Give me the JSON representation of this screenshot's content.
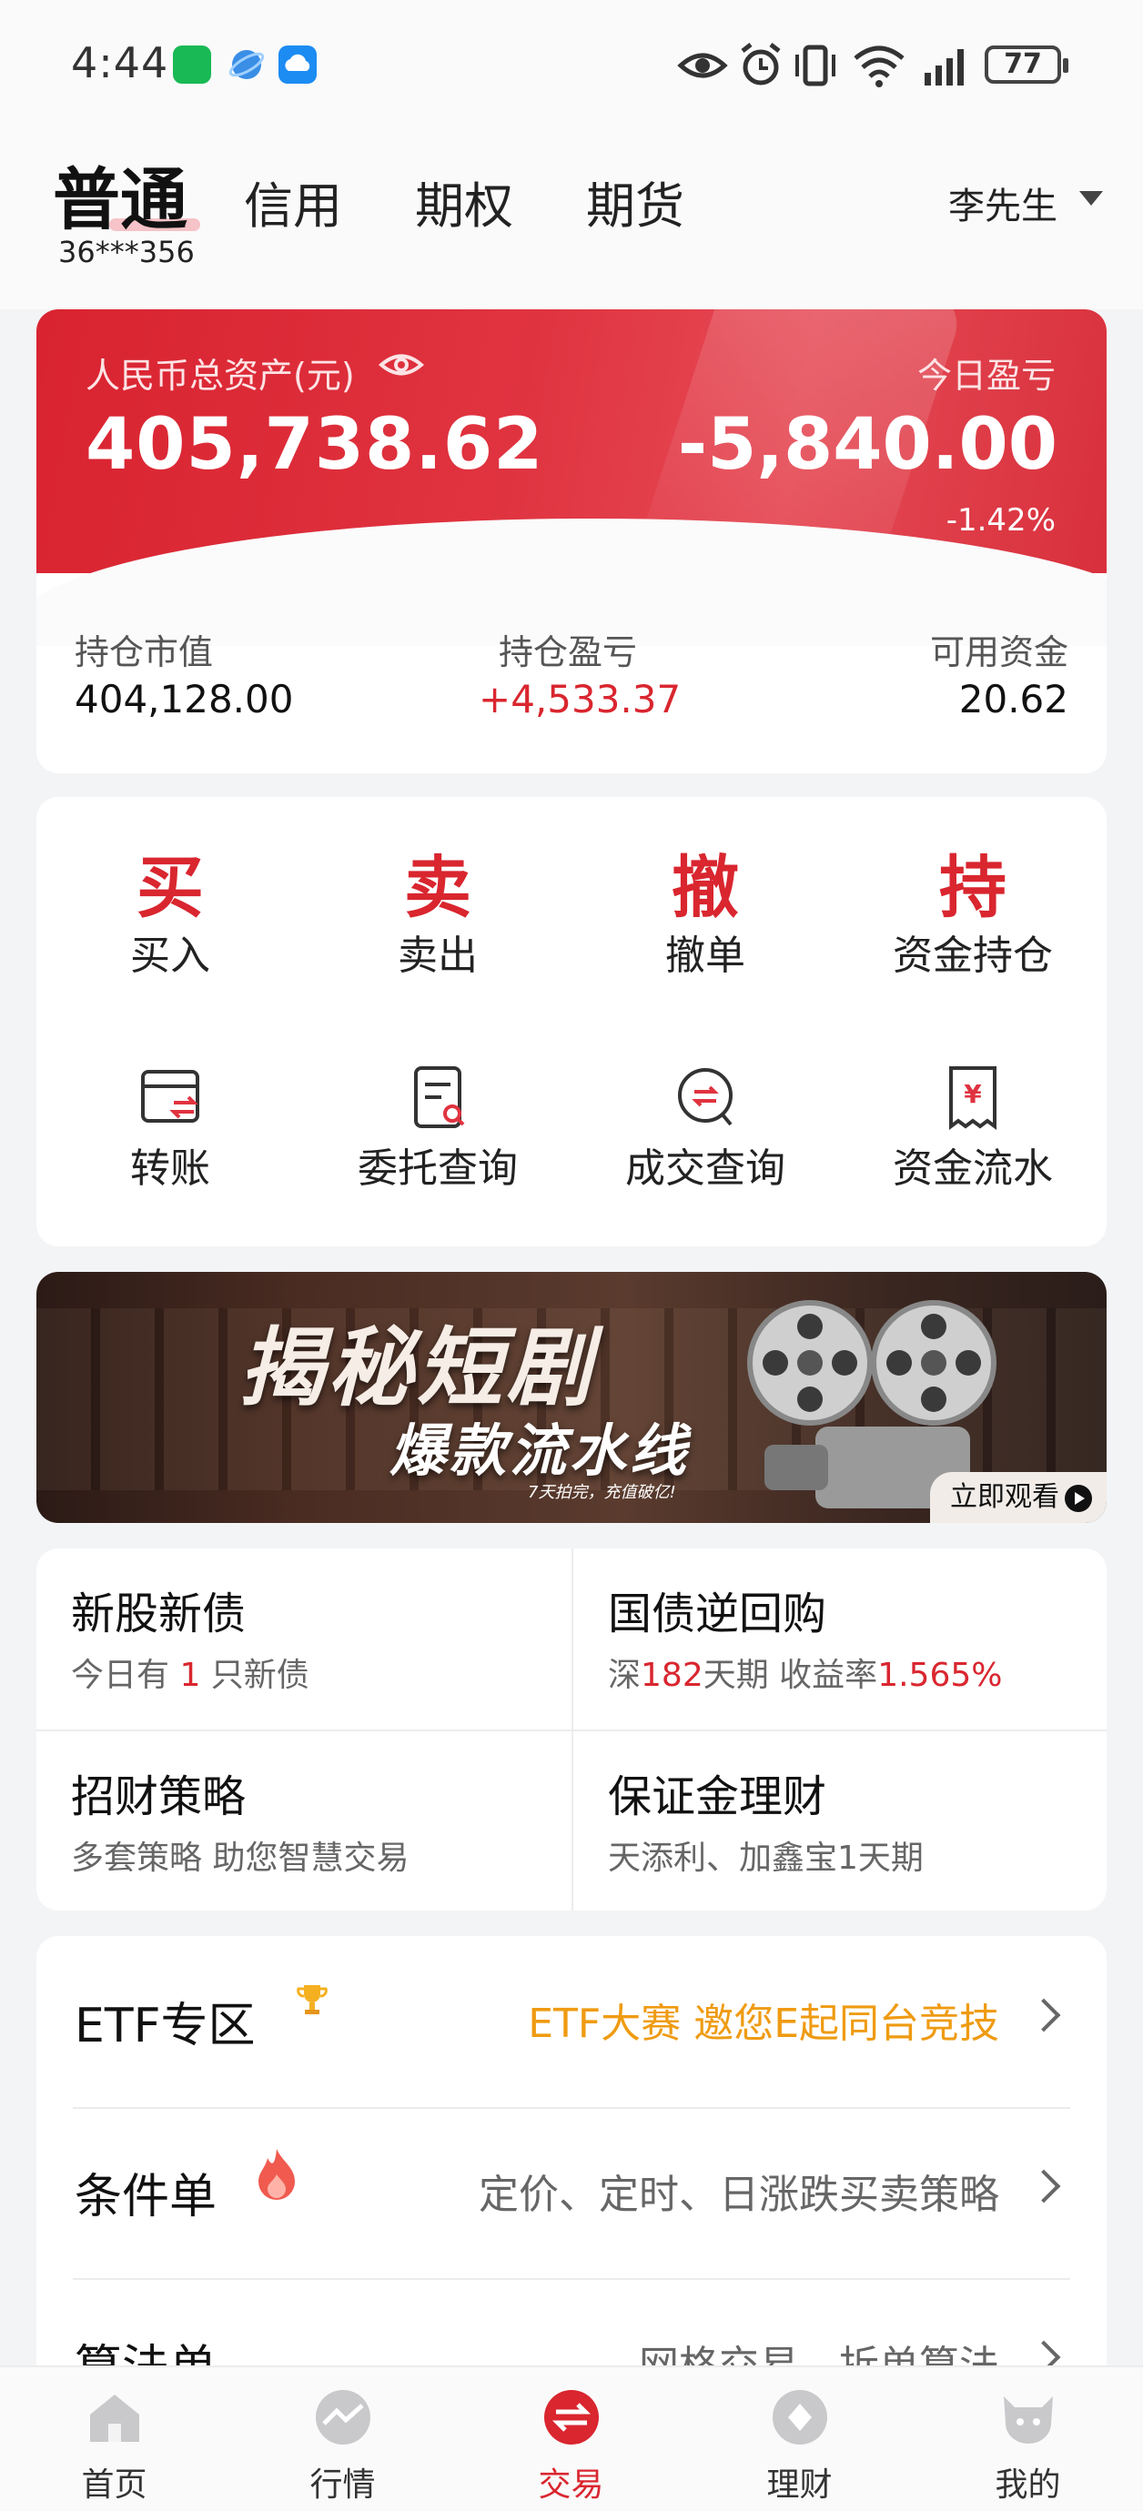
{
  "status_bar": {
    "time": "4:44",
    "battery": "77",
    "icons": [
      "wechat-icon",
      "browser-icon",
      "cloud-icon",
      "eye-icon",
      "alarm-icon",
      "vibrate-icon",
      "wifi-icon",
      "signal-icon"
    ]
  },
  "header": {
    "tabs": [
      "普通",
      "信用",
      "期权",
      "期货"
    ],
    "active_tab": "普通",
    "account_no": "36***356",
    "user_name": "李先生"
  },
  "assets": {
    "total_label": "人民币总资产(元)",
    "total_value": "405,738.62",
    "today_label": "今日盈亏",
    "today_value": "-5,840.00",
    "today_pct": "-1.42%",
    "position_value_label": "持仓市值",
    "position_value": "404,128.00",
    "position_pl_label": "持仓盈亏",
    "position_pl": "+4,533.37",
    "available_label": "可用资金",
    "available": "20.62",
    "colors": {
      "card_red": "#d92330",
      "gain_red": "#d9262f"
    }
  },
  "quick_actions": [
    {
      "glyph": "买",
      "label": "买入"
    },
    {
      "glyph": "卖",
      "label": "卖出"
    },
    {
      "glyph": "撤",
      "label": "撤单"
    },
    {
      "glyph": "持",
      "label": "资金持仓"
    }
  ],
  "tools": [
    {
      "icon": "transfer-icon",
      "label": "转账"
    },
    {
      "icon": "order-query-icon",
      "label": "委托查询"
    },
    {
      "icon": "deal-query-icon",
      "label": "成交查询"
    },
    {
      "icon": "cash-flow-icon",
      "label": "资金流水"
    }
  ],
  "banner": {
    "title": "揭秘短剧",
    "subtitle": "爆款流水线",
    "small": "7天拍完，充值破亿!",
    "button": "立即观看"
  },
  "services": [
    {
      "title": "新股新债",
      "sub_prefix": "今日有 ",
      "sub_highlight": "1",
      "sub_suffix": " 只新债"
    },
    {
      "title": "国债逆回购",
      "sub_prefix": "深",
      "sub_highlight": "182",
      "sub_mid": "天期 收益率",
      "sub_highlight2": "1.565%"
    },
    {
      "title": "招财策略",
      "sub": "多套策略 助您智慧交易"
    },
    {
      "title": "保证金理财",
      "sub": "天添利、加鑫宝1天期"
    }
  ],
  "list": [
    {
      "title": "ETF专区",
      "desc": "ETF大赛 邀您E起同台竞技",
      "badge": "trophy-icon"
    },
    {
      "title": "条件单",
      "desc": "定价、定时、日涨跌买卖策略",
      "badge": "flame-icon"
    },
    {
      "title": "算法单",
      "desc": "网格交易、拆单算法"
    }
  ],
  "bottom_nav": [
    {
      "label": "首页",
      "icon": "home-icon"
    },
    {
      "label": "行情",
      "icon": "market-icon"
    },
    {
      "label": "交易",
      "icon": "trade-icon",
      "active": true
    },
    {
      "label": "理财",
      "icon": "wealth-icon"
    },
    {
      "label": "我的",
      "icon": "profile-icon"
    }
  ]
}
